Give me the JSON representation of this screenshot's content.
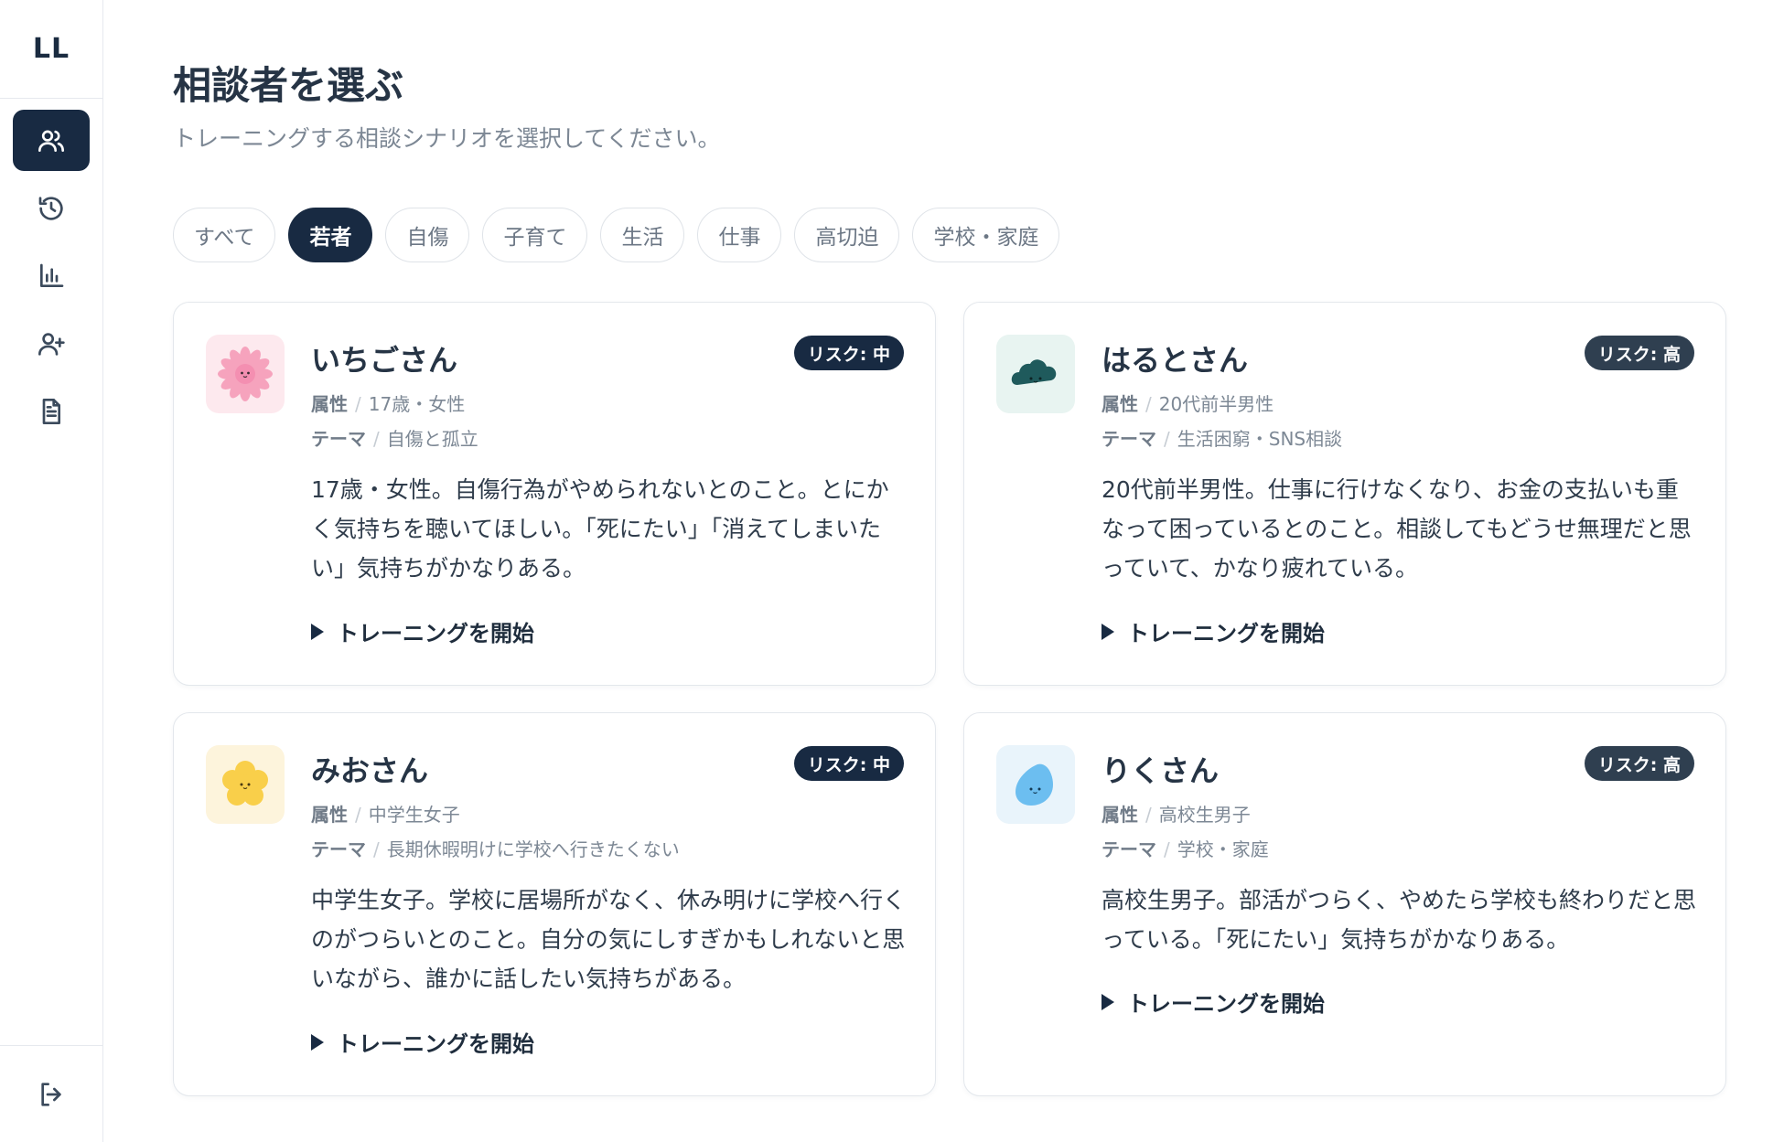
{
  "app": {
    "logo": "LL"
  },
  "sidebar": {
    "items": [
      {
        "name": "clients",
        "icon": "users-icon",
        "active": true
      },
      {
        "name": "history",
        "icon": "history-icon",
        "active": false
      },
      {
        "name": "stats",
        "icon": "bar-chart-icon",
        "active": false
      },
      {
        "name": "add-user",
        "icon": "user-plus-icon",
        "active": false
      },
      {
        "name": "documents",
        "icon": "document-icon",
        "active": false
      }
    ],
    "bottom_icon": "logout-icon"
  },
  "header": {
    "title": "相談者を選ぶ",
    "subtitle": "トレーニングする相談シナリオを選択してください。"
  },
  "filters": [
    {
      "label": "すべて",
      "active": false
    },
    {
      "label": "若者",
      "active": true
    },
    {
      "label": "自傷",
      "active": false
    },
    {
      "label": "子育て",
      "active": false
    },
    {
      "label": "生活",
      "active": false
    },
    {
      "label": "仕事",
      "active": false
    },
    {
      "label": "高切迫",
      "active": false
    },
    {
      "label": "学校・家庭",
      "active": false
    }
  ],
  "labels": {
    "attr_key": "属性",
    "theme_key": "テーマ",
    "start": "トレーニングを開始"
  },
  "cards": [
    {
      "name": "いちごさん",
      "avatar": "pink-flower-avatar",
      "risk": "リスク: 中",
      "attr": "17歳・女性",
      "theme": "自傷と孤立",
      "description": "17歳・女性。自傷行為がやめられないとのこと。とにかく気持ちを聴いてほしい。「死にたい」「消えてしまいたい」気持ちがかなりある。"
    },
    {
      "name": "はるとさん",
      "avatar": "dark-cloud-avatar",
      "risk": "リスク: 高",
      "attr": "20代前半男性",
      "theme": "生活困窮・SNS相談",
      "description": "20代前半男性。仕事に行けなくなり、お金の支払いも重なって困っているとのこと。相談してもどうせ無理だと思っていて、かなり疲れている。"
    },
    {
      "name": "みおさん",
      "avatar": "yellow-flower-avatar",
      "risk": "リスク: 中",
      "attr": "中学生女子",
      "theme": "長期休暇明けに学校へ行きたくない",
      "description": "中学生女子。学校に居場所がなく、休み明けに学校へ行くのがつらいとのこと。自分の気にしすぎかもしれないと思いながら、誰かに話したい気持ちがある。"
    },
    {
      "name": "りくさん",
      "avatar": "blue-drop-avatar",
      "risk": "リスク: 高",
      "attr": "高校生男子",
      "theme": "学校・家庭",
      "description": "高校生男子。部活がつらく、やめたら学校も終わりだと思っている。「死にたい」気持ちがかなりある。"
    }
  ]
}
